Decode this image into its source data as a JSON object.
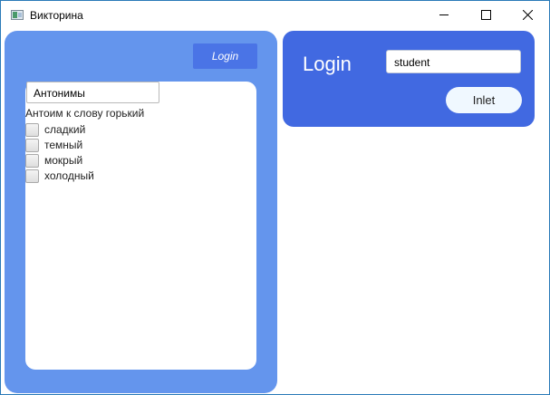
{
  "window": {
    "title": "Викторина"
  },
  "left": {
    "login_button": "Login",
    "topic": "Антонимы",
    "question": "Антоим к слову горький",
    "options": [
      "сладкий",
      "темный",
      "мокрый",
      "холодный"
    ]
  },
  "right": {
    "login_label": "Login",
    "username": "student",
    "inlet_button": "Inlet"
  },
  "colors": {
    "left_panel": "#6495ed",
    "right_panel": "#4169e1",
    "login_button": "#4a74e6",
    "inlet_button": "#f0f8ff"
  }
}
